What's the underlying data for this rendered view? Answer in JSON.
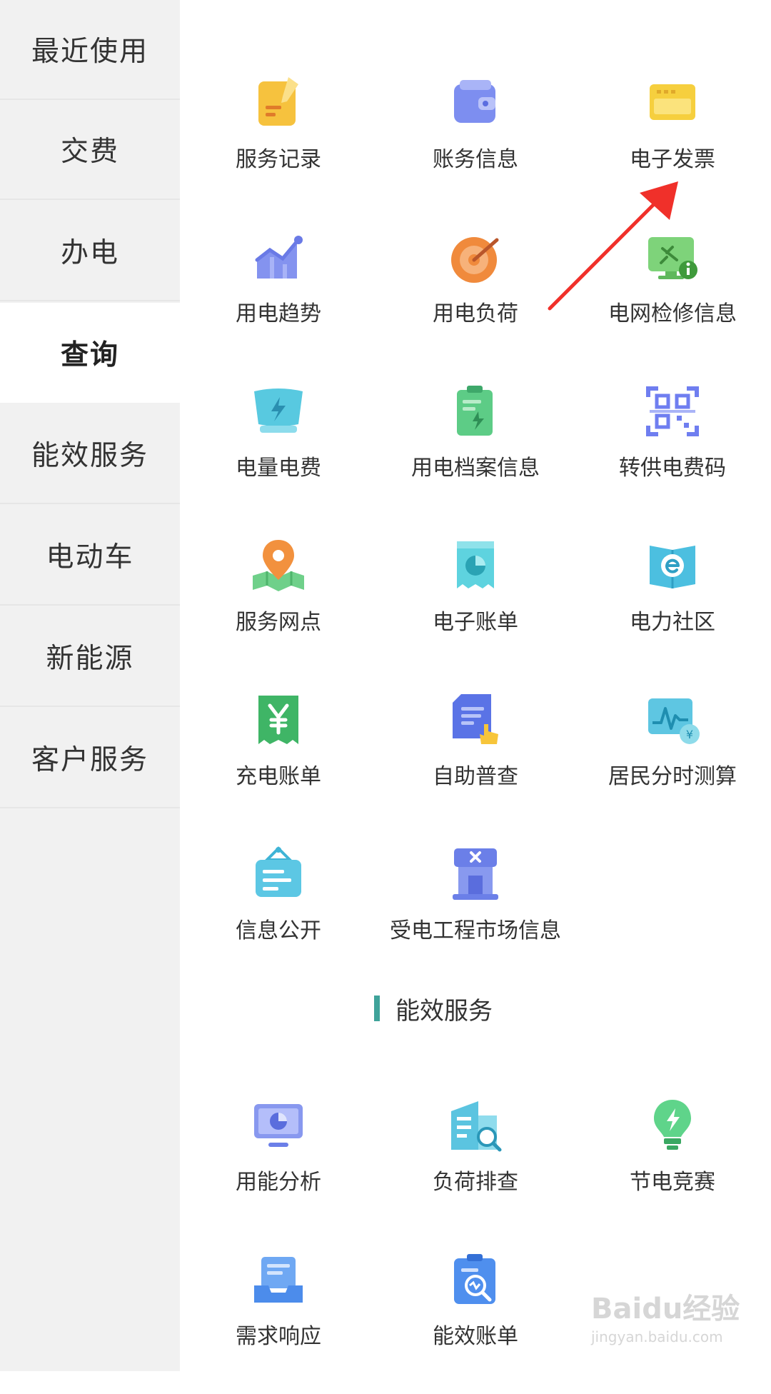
{
  "sidebar": {
    "items": [
      {
        "label": "最近使用",
        "active": false
      },
      {
        "label": "交费",
        "active": false
      },
      {
        "label": "办电",
        "active": false
      },
      {
        "label": "查询",
        "active": true
      },
      {
        "label": "能效服务",
        "active": false
      },
      {
        "label": "电动车",
        "active": false
      },
      {
        "label": "新能源",
        "active": false
      },
      {
        "label": "客户服务",
        "active": false
      }
    ]
  },
  "query": {
    "tiles": [
      {
        "label": "服务记录",
        "icon": "note-icon"
      },
      {
        "label": "账务信息",
        "icon": "wallet-icon"
      },
      {
        "label": "电子发票",
        "icon": "invoice-icon"
      },
      {
        "label": "用电趋势",
        "icon": "trend-chart-icon"
      },
      {
        "label": "用电负荷",
        "icon": "target-gauge-icon"
      },
      {
        "label": "电网检修信息",
        "icon": "maintenance-monitor-icon"
      },
      {
        "label": "电量电费",
        "icon": "energy-bill-icon"
      },
      {
        "label": "用电档案信息",
        "icon": "archive-clipboard-icon"
      },
      {
        "label": "转供电费码",
        "icon": "qr-code-icon"
      },
      {
        "label": "服务网点",
        "icon": "map-pin-icon"
      },
      {
        "label": "电子账单",
        "icon": "pie-bill-icon"
      },
      {
        "label": "电力社区",
        "icon": "community-book-icon"
      },
      {
        "label": "充电账单",
        "icon": "yuan-receipt-icon"
      },
      {
        "label": "自助普查",
        "icon": "self-check-icon"
      },
      {
        "label": "居民分时测算",
        "icon": "time-of-use-icon"
      },
      {
        "label": "信息公开",
        "icon": "notice-board-icon"
      },
      {
        "label": "受电工程市场信息",
        "icon": "market-building-icon"
      }
    ]
  },
  "efficiency": {
    "title": "能效服务",
    "tiles": [
      {
        "label": "用能分析",
        "icon": "monitor-pie-icon"
      },
      {
        "label": "负荷排查",
        "icon": "building-search-icon"
      },
      {
        "label": "节电竞赛",
        "icon": "bulb-icon"
      },
      {
        "label": "需求响应",
        "icon": "inbox-tray-icon"
      },
      {
        "label": "能效账单",
        "icon": "clipboard-search-icon"
      }
    ]
  },
  "watermark": {
    "brand": "Baidu经验",
    "site": "jingyan.baidu.com"
  },
  "colors": {
    "accent": "#3fa39a",
    "arrow": "#f0302a",
    "sidebar_bg": "#f1f1f1"
  }
}
